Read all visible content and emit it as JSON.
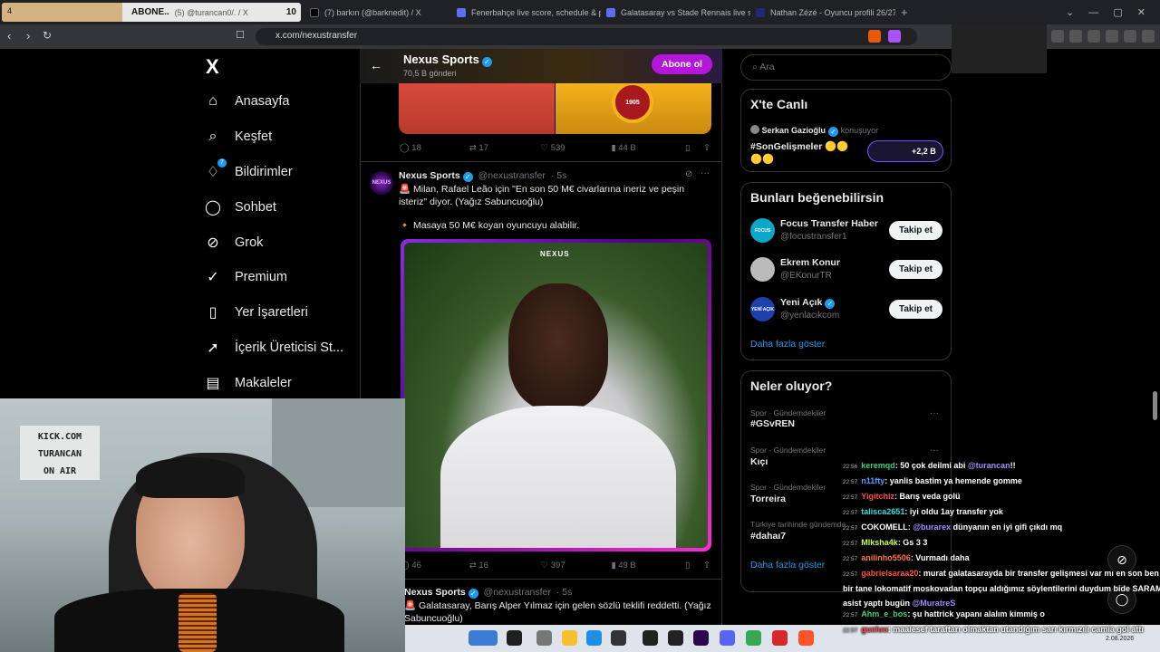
{
  "browser": {
    "tabs": [
      {
        "label": "4",
        "extra_label": "ABONE..",
        "handle": "(5) @turancan0/. / X",
        "count": "10"
      },
      {
        "label": "(7) barkın (@barknedit) / X"
      },
      {
        "label": "Fenerbahçe live score, schedule & pl"
      },
      {
        "label": "Galatasaray vs Stade Rennais live sco"
      },
      {
        "label": "Nathan Zézé - Oyuncu profili 26/27"
      }
    ],
    "new_tab": "+",
    "url": "x.com/nexustransfer"
  },
  "sidebar": {
    "logo": "X",
    "items": [
      {
        "label": "Anasayfa",
        "icon": "home-icon"
      },
      {
        "label": "Keşfet",
        "icon": "search-icon"
      },
      {
        "label": "Bildirimler",
        "icon": "bell-icon",
        "badge": "7"
      },
      {
        "label": "Sohbet",
        "icon": "chat-icon"
      },
      {
        "label": "Grok",
        "icon": "grok-icon"
      },
      {
        "label": "Premium",
        "icon": "premium-icon"
      },
      {
        "label": "Yer İşaretleri",
        "icon": "bookmark-icon"
      },
      {
        "label": "İçerik Üreticisi St...",
        "icon": "rocket-icon"
      },
      {
        "label": "Makaleler",
        "icon": "article-icon"
      }
    ]
  },
  "profile_header": {
    "name": "Nexus Sports",
    "posts": "70,5 B gönderi",
    "subscribe": "Abone ol",
    "image_badge": "1905"
  },
  "tweets": [
    {
      "stats": {
        "replies": "18",
        "retweets": "17",
        "likes": "539",
        "views": "44 B"
      }
    },
    {
      "name": "Nexus Sports",
      "handle": "@nexustransfer",
      "time": "· 5s",
      "text1": "🚨 Milan, Rafael Leão için \"En son 50 M€ civarlarına ineriz ve peşin isteriz\" diyor. (Yağız Sabuncuoğlu)",
      "text2": "🔸 Masaya 50 M€ koyan oyuncuyu alabilir.",
      "media_logo": "NEXUS",
      "stats": {
        "replies": "46",
        "retweets": "16",
        "likes": "397",
        "views": "49 B"
      }
    },
    {
      "name": "Nexus Sports",
      "handle": "@nexustransfer",
      "time": "· 5s",
      "text1": "🚨 Galatasaray, Barış Alper Yılmaz için gelen sözlü teklifi reddetti. (Yağız Sabuncuoğlu)"
    }
  ],
  "right": {
    "search_placeholder": "Ara",
    "live": {
      "title": "X'te Canlı",
      "host": "Serkan Gazioğlu",
      "status": "konuşuyor",
      "tag": "#SonGelişmeler 🟡🟡🟡🟡",
      "listeners": "+2,2 B"
    },
    "suggest": {
      "title": "Bunları beğenebilirsin",
      "users": [
        {
          "name": "Focus Transfer Haber",
          "handle": "@focustransfer1",
          "button": "Takip et",
          "avatar_text": "FOCUS"
        },
        {
          "name": "Ekrem Konur",
          "handle": "@EKonurTR",
          "button": "Takip et",
          "avatar_text": ""
        },
        {
          "name": "Yeni Açık",
          "handle": "@yenlacikcom",
          "button": "Takip et",
          "avatar_text": "YENİ AÇIK"
        }
      ],
      "more": "Daha fazla göster"
    },
    "trends": {
      "title": "Neler oluyor?",
      "items": [
        {
          "category": "Spor · Gündemdekiler",
          "name": "#GSvREN"
        },
        {
          "category": "Spor · Gündemdekiler",
          "name": "Kıçı"
        },
        {
          "category": "Spor · Gündemdekiler",
          "name": "Torreira"
        },
        {
          "category": "Türkiye tarihinde gündemde",
          "name": "#dahaı7"
        }
      ],
      "more": "Daha fazla göster"
    }
  },
  "webcam": {
    "sign_lines": [
      "KICK.COM",
      "TURANCAN",
      "ON AIR"
    ]
  },
  "chat": [
    {
      "time": "22:56",
      "user": "keremqd",
      "user_color": "#3ecf7a",
      "msg": ": 50 çok deilmi abi ",
      "mention": "@turancan",
      "tail": "!!"
    },
    {
      "time": "22:57",
      "user": "n11fty",
      "user_color": "#4aa3ff",
      "msg": ": yanlis bastim ya hemende gomme"
    },
    {
      "time": "22:57",
      "user": "Yigitchiz",
      "user_color": "#ff4d4d",
      "msg": ": Barış veda golü"
    },
    {
      "time": "22:57",
      "user": "talisca2651",
      "user_color": "#33e0d6",
      "msg": ": iyi oldu 1ay transfer yok"
    },
    {
      "time": "22:57",
      "user": "COKOMELL",
      "user_color": "#ffffff",
      "msg": ": ",
      "mention": "@burarex",
      "tail": " dünyanın en iyi gifi çıkdı mq"
    },
    {
      "time": "22:57",
      "user": "Mlksha4k",
      "user_color": "#c9ff4d",
      "msg": ": Gs 3 3"
    },
    {
      "time": "22:57",
      "user": "anilinho5506",
      "user_color": "#ff7a3d",
      "msg": ": Vurmadı daha"
    },
    {
      "time": "22:57",
      "user": "gabrielsaraa20",
      "user_color": "#ff4d4d",
      "msg": ": murat galatasarayda bir transfer gelişmesi var mı en son ben"
    },
    {
      "time": "",
      "user": "",
      "user_color": "#ffffff",
      "msg": "bir tane lokomatif moskovadan topçu aldığımız söylentilerini duydum bide SARAM"
    },
    {
      "time": "",
      "user": "",
      "user_color": "#ffffff",
      "msg": "asist yaptı bugün ",
      "mention": "@MuratreS"
    },
    {
      "time": "22:57",
      "user": "Ahm_e_bos",
      "user_color": "#3ecf7a",
      "msg": ": şu hattrick yapanı alalım kimmiş o"
    },
    {
      "time": "22:57",
      "user": "gucluu",
      "user_color": "#ff4d4d",
      "msg": ": maalesef taraftarı olmaktan utandığım sarı kırmızılı camia gol attı"
    }
  ],
  "taskbar": {
    "date": "2.08.2026"
  }
}
